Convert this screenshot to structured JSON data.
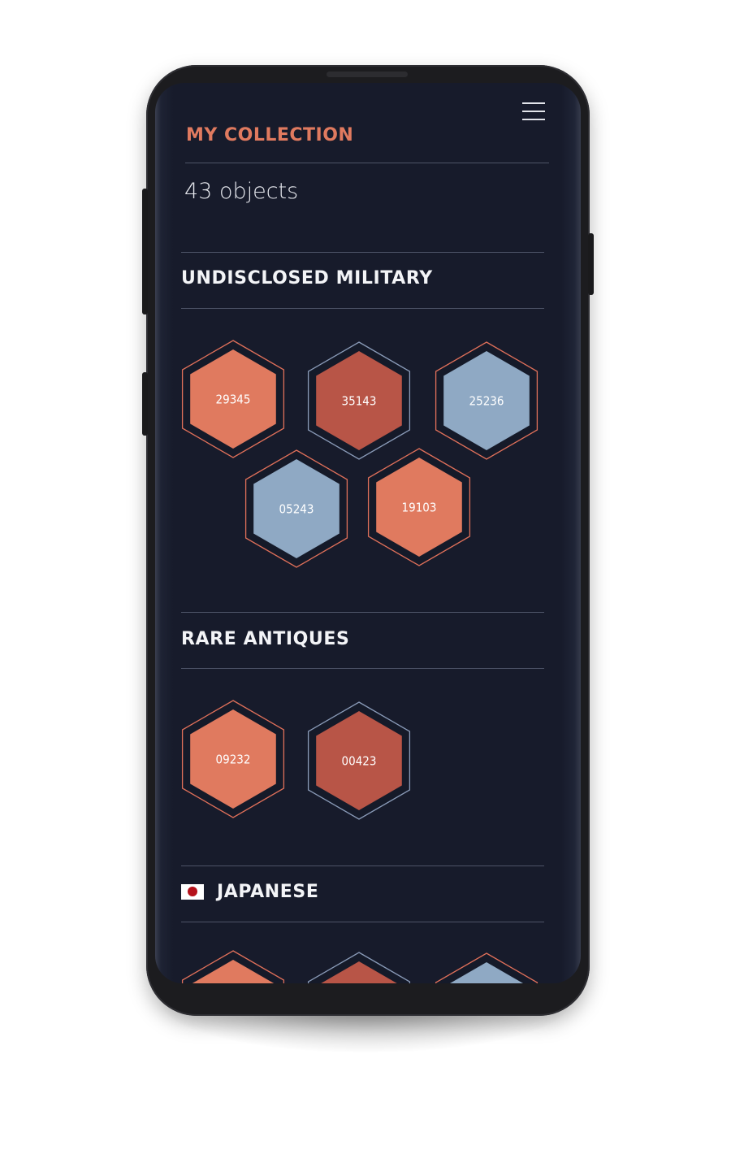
{
  "header": {
    "title": "MY COLLECTION",
    "object_count": "43 objects",
    "menu_icon": "hamburger-menu-icon"
  },
  "sections": [
    {
      "title": "UNDISCLOSED MILITARY",
      "items": [
        {
          "code": "29345",
          "fill": "#e07a5f",
          "outline": "#e0705a"
        },
        {
          "code": "35143",
          "fill": "#b85547",
          "outline": "#8a9bb8"
        },
        {
          "code": "25236",
          "fill": "#8fa9c4",
          "outline": "#e0705a"
        },
        {
          "code": "05243",
          "fill": "#8fa9c4",
          "outline": "#e0705a"
        },
        {
          "code": "19103",
          "fill": "#e07a5f",
          "outline": "#e0705a"
        }
      ]
    },
    {
      "title": "RARE ANTIQUES",
      "items": [
        {
          "code": "09232",
          "fill": "#e07a5f",
          "outline": "#e0705a"
        },
        {
          "code": "00423",
          "fill": "#b85547",
          "outline": "#8a9bb8"
        }
      ]
    },
    {
      "title": "JAPANESE",
      "flag_icon": "japan-flag-icon",
      "items": [
        {
          "code": "",
          "fill": "#e07a5f",
          "outline": "#e0705a"
        },
        {
          "code": "",
          "fill": "#b85547",
          "outline": "#8a9bb8"
        },
        {
          "code": "",
          "fill": "#8fa9c4",
          "outline": "#e0705a"
        }
      ]
    }
  ],
  "colors": {
    "background": "#171b2b",
    "accent": "#e07a5f",
    "divider": "#4d5367",
    "inner_ring": "#151a29"
  }
}
